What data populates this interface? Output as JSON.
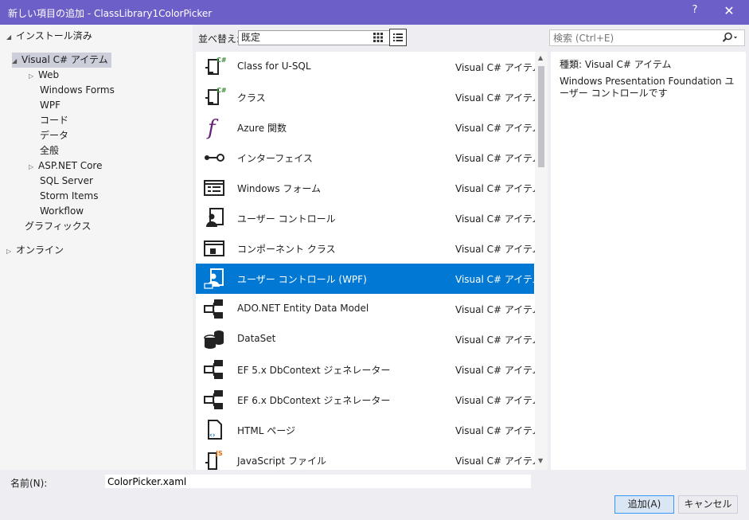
{
  "window": {
    "title": "新しい項目の追加 - ClassLibrary1ColorPicker",
    "help_label": "?",
    "close_label": "✕"
  },
  "tree": {
    "installed": "インストール済み",
    "csharp": "Visual C# アイテム",
    "web": "Web",
    "winforms": "Windows Forms",
    "wpf": "WPF",
    "code": "コード",
    "data": "データ",
    "general": "全般",
    "aspnet": "ASP.NET Core",
    "sql": "SQL Server",
    "storm": "Storm Items",
    "workflow": "Workflow",
    "graphics": "グラフィックス",
    "online": "オンライン"
  },
  "toolbar": {
    "sort_label": "並べ替え:",
    "sort_value": "既定",
    "grid_view_icon": "grid-view-icon",
    "list_view_icon": "list-view-icon"
  },
  "search": {
    "placeholder": "検索 (Ctrl+E)",
    "icon": "search-icon"
  },
  "templates": [
    {
      "name": "Class for U-SQL",
      "category": "Visual C# アイテム",
      "icon": "csharp-class-icon"
    },
    {
      "name": "クラス",
      "category": "Visual C# アイテム",
      "icon": "csharp-class-icon"
    },
    {
      "name": "Azure 関数",
      "category": "Visual C# アイテム",
      "icon": "azure-function-icon"
    },
    {
      "name": "インターフェイス",
      "category": "Visual C# アイテム",
      "icon": "interface-icon"
    },
    {
      "name": "Windows フォーム",
      "category": "Visual C# アイテム",
      "icon": "windows-form-icon"
    },
    {
      "name": "ユーザー コントロール",
      "category": "Visual C# アイテム",
      "icon": "user-control-icon"
    },
    {
      "name": "コンポーネント クラス",
      "category": "Visual C# アイテム",
      "icon": "component-class-icon"
    },
    {
      "name": "ユーザー コントロール (WPF)",
      "category": "Visual C# アイテム",
      "icon": "wpf-user-control-icon"
    },
    {
      "name": "ADO.NET Entity Data Model",
      "category": "Visual C# アイテム",
      "icon": "entity-model-icon"
    },
    {
      "name": "DataSet",
      "category": "Visual C# アイテム",
      "icon": "dataset-icon"
    },
    {
      "name": "EF 5.x DbContext ジェネレーター",
      "category": "Visual C# アイテム",
      "icon": "entity-model-icon"
    },
    {
      "name": "EF 6.x DbContext ジェネレーター",
      "category": "Visual C# アイテム",
      "icon": "entity-model-icon"
    },
    {
      "name": "HTML ページ",
      "category": "Visual C# アイテム",
      "icon": "html-page-icon"
    },
    {
      "name": "JavaScript ファイル",
      "category": "Visual C# アイテム",
      "icon": "javascript-file-icon"
    }
  ],
  "details": {
    "type_label": "種類:",
    "type_value": "Visual C# アイテム",
    "description": "Windows Presentation Foundation ユーザー コントロールです"
  },
  "footer": {
    "name_label": "名前(N):",
    "name_value": "ColorPicker.xaml",
    "add_button": "追加(A)",
    "cancel_button": "キャンセル"
  },
  "colors": {
    "title_bar": "#6c5fc7",
    "selection": "#0078d4",
    "tree_selection": "#ccceda"
  }
}
